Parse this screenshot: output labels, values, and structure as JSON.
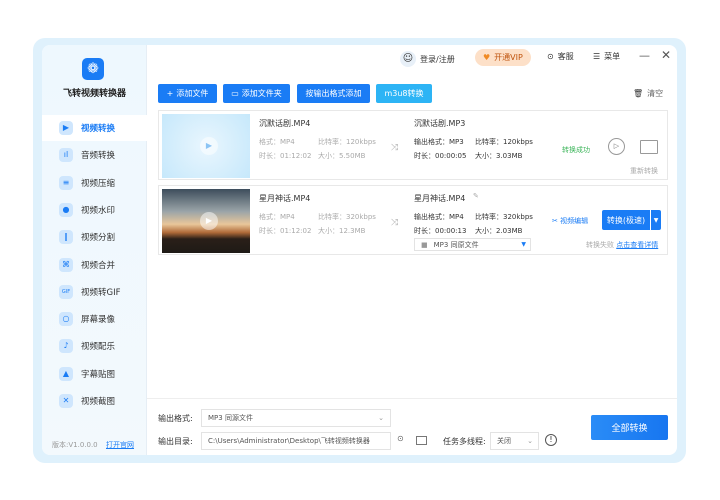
{
  "app": {
    "name": "飞转视频转换器",
    "version": "版本:V1.0.0.0",
    "website": "打开官网"
  },
  "sidebar": {
    "items": [
      {
        "label": "视频转换",
        "icon": "video-convert-icon"
      },
      {
        "label": "音频转换",
        "icon": "audio-icon"
      },
      {
        "label": "视频压缩",
        "icon": "compress-icon"
      },
      {
        "label": "视频水印",
        "icon": "watermark-icon"
      },
      {
        "label": "视频分割",
        "icon": "split-icon"
      },
      {
        "label": "视频合并",
        "icon": "merge-icon"
      },
      {
        "label": "视频转GIF",
        "icon": "gif-icon"
      },
      {
        "label": "屏幕录像",
        "icon": "record-icon"
      },
      {
        "label": "视频配乐",
        "icon": "music-icon"
      },
      {
        "label": "字幕贴图",
        "icon": "image-icon"
      },
      {
        "label": "视频截图",
        "icon": "screenshot-icon"
      }
    ]
  },
  "header": {
    "login": "登录/注册",
    "vip": "开通VIP",
    "service": "客服",
    "menu": "菜单"
  },
  "toolbar": {
    "add_file": "添加文件",
    "add_folder": "添加文件夹",
    "add_by_format": "按输出格式添加",
    "m3u8": "m3u8转换",
    "clear": "清空"
  },
  "files": [
    {
      "name": "沉默话剧.MP4",
      "format": "格式：MP4",
      "bitrate": "比特率：120kbps",
      "duration": "时长：01:12:02",
      "size": "大小：5.50MB",
      "out_name": "沉默话剧.MP3",
      "out_format": "输出格式：MP3",
      "out_bitrate": "比特率：120kbps",
      "out_duration": "时长：00:00:05",
      "out_size": "大小：3.03MB",
      "status": "转换成功",
      "reconvert": "重新转换"
    },
    {
      "name": "星月神话.MP4",
      "format": "格式：MP4",
      "bitrate": "比特率：320kbps",
      "duration": "时长：01:12:02",
      "size": "大小：12.3MB",
      "out_name": "星月神话.MP4",
      "out_format": "输出格式：MP4",
      "out_bitrate": "比特率：320kbps",
      "out_duration": "时长：00:00:13",
      "out_size": "大小：2.03MB",
      "preset": "MP3 同原文件",
      "edit": "视频编辑",
      "convert": "转换(极速)",
      "fail": "转换失败",
      "detail": "点击查看详情"
    }
  ],
  "bottom": {
    "format_label": "输出格式:",
    "format_value": "MP3  同源文件",
    "dir_label": "输出目录:",
    "dir_value": "C:\\Users\\Administrator\\Desktop\\飞转视频转换器",
    "thread_label": "任务多线程:",
    "thread_value": "关闭",
    "convert_all": "全部转换"
  }
}
